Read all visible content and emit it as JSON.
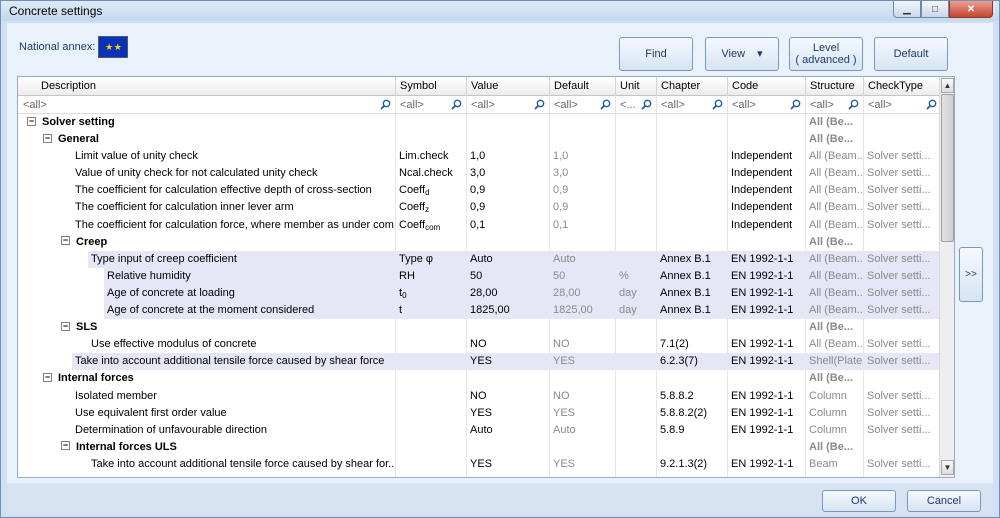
{
  "window": {
    "title": "Concrete settings",
    "minimize": "▁",
    "maximize": "□",
    "close": "✕"
  },
  "national_annex": {
    "label": "National annex:",
    "flag_glyph": "★ ★"
  },
  "toolbar": {
    "find": "Find",
    "view": "View",
    "view_arrow": "▾",
    "level_line1": "Level",
    "level_line2": "( advanced )",
    "default": "Default"
  },
  "columns": [
    "Description",
    "Symbol",
    "Value",
    "Default",
    "Unit",
    "Chapter",
    "Code",
    "Structure",
    "CheckType"
  ],
  "filters": [
    "<all>",
    "<all>",
    "<all>",
    "<all>",
    "<...",
    "<all>",
    "<all>",
    "<all>",
    "<all>"
  ],
  "rows": [
    {
      "indent": 0,
      "toggle": "⊟",
      "bold": true,
      "desc": "Solver setting",
      "symbol": "",
      "value": "",
      "default": "",
      "unit": "",
      "chapter": "",
      "code": "",
      "structure": "All (Be...",
      "structure_bold": true,
      "checktype": "",
      "hl": false
    },
    {
      "indent": 1,
      "toggle": "⊟",
      "bold": true,
      "desc": "General",
      "symbol": "",
      "value": "",
      "default": "",
      "unit": "",
      "chapter": "",
      "code": "",
      "structure": "All (Be...",
      "structure_bold": true,
      "checktype": "",
      "hl": false
    },
    {
      "indent": 2,
      "toggle": "",
      "bold": false,
      "desc": "Limit value of unity check",
      "symbol": "Lim.check",
      "value": "1,0",
      "default": "1,0",
      "unit": "",
      "chapter": "",
      "code": "Independent",
      "structure": "All (Beam...",
      "checktype": "Solver setti...",
      "hl": false
    },
    {
      "indent": 2,
      "toggle": "",
      "bold": false,
      "desc": "Value of unity check for not calculated unity check",
      "symbol": "Ncal.check",
      "value": "3,0",
      "default": "3,0",
      "unit": "",
      "chapter": "",
      "code": "Independent",
      "structure": "All (Beam...",
      "checktype": "Solver setti...",
      "hl": false
    },
    {
      "indent": 2,
      "toggle": "",
      "bold": false,
      "desc": "The coefficient for calculation effective depth of cross-section",
      "symbol": "Coeff",
      "sub": "d",
      "value": "0,9",
      "default": "0,9",
      "unit": "",
      "chapter": "",
      "code": "Independent",
      "structure": "All (Beam...",
      "checktype": "Solver setti...",
      "hl": false
    },
    {
      "indent": 2,
      "toggle": "",
      "bold": false,
      "desc": "The coefficient for calculation inner lever arm",
      "symbol": "Coeff",
      "sub": "z",
      "value": "0,9",
      "default": "0,9",
      "unit": "",
      "chapter": "",
      "code": "Independent",
      "structure": "All (Beam...",
      "checktype": "Solver setti...",
      "hl": false
    },
    {
      "indent": 2,
      "toggle": "",
      "bold": false,
      "desc": "The coefficient for calculation force, where member as under com...",
      "symbol": "Coeff",
      "sub": "com",
      "value": "0,1",
      "default": "0,1",
      "unit": "",
      "chapter": "",
      "code": "Independent",
      "structure": "All (Beam...",
      "checktype": "Solver setti...",
      "hl": false
    },
    {
      "indent": 2,
      "toggle": "⊟",
      "bold": true,
      "desc": "Creep",
      "symbol": "",
      "value": "",
      "default": "",
      "unit": "",
      "chapter": "",
      "code": "",
      "structure": "All (Be...",
      "structure_bold": true,
      "checktype": "",
      "hl": false
    },
    {
      "indent": 3,
      "toggle": "",
      "bold": false,
      "desc": "Type input of creep coefficient",
      "symbol": "Type φ",
      "value": "Auto",
      "default": "Auto",
      "unit": "",
      "chapter": "Annex B.1",
      "code": "EN 1992-1-1",
      "structure": "All (Beam...",
      "checktype": "Solver setti...",
      "hl": true
    },
    {
      "indent": 4,
      "toggle": "",
      "bold": false,
      "desc": "Relative humidity",
      "symbol": "RH",
      "value": "50",
      "default": "50",
      "unit": "%",
      "chapter": "Annex B.1",
      "code": "EN 1992-1-1",
      "structure": "All (Beam...",
      "checktype": "Solver setti...",
      "hl": true
    },
    {
      "indent": 4,
      "toggle": "",
      "bold": false,
      "desc": "Age of concrete at loading",
      "symbol": "t",
      "sub": "0",
      "value": "28,00",
      "default": "28,00",
      "unit": "day",
      "chapter": "Annex B.1",
      "code": "EN 1992-1-1",
      "structure": "All (Beam...",
      "checktype": "Solver setti...",
      "hl": true
    },
    {
      "indent": 4,
      "toggle": "",
      "bold": false,
      "desc": "Age of concrete at the moment considered",
      "symbol": "t",
      "value": "1825,00",
      "default": "1825,00",
      "unit": "day",
      "chapter": "Annex B.1",
      "code": "EN 1992-1-1",
      "structure": "All (Beam...",
      "checktype": "Solver setti...",
      "hl": true
    },
    {
      "indent": 2,
      "toggle": "⊟",
      "bold": true,
      "desc": "SLS",
      "symbol": "",
      "value": "",
      "default": "",
      "unit": "",
      "chapter": "",
      "code": "",
      "structure": "All (Be...",
      "structure_bold": true,
      "checktype": "",
      "hl": false
    },
    {
      "indent": 3,
      "toggle": "",
      "bold": false,
      "desc": "Use effective modulus of concrete",
      "symbol": "",
      "value": "NO",
      "default": "NO",
      "unit": "",
      "chapter": "7.1(2)",
      "code": "EN 1992-1-1",
      "structure": "All (Beam...",
      "checktype": "Solver setti...",
      "hl": false
    },
    {
      "indent": 2,
      "toggle": "",
      "bold": false,
      "desc": "Take into account additional tensile force caused by shear force",
      "symbol": "",
      "value": "YES",
      "default": "YES",
      "unit": "",
      "chapter": "6.2.3(7)",
      "code": "EN 1992-1-1",
      "structure": "Shell(Plate)",
      "checktype": "Solver setti...",
      "hl": true
    },
    {
      "indent": 1,
      "toggle": "⊟",
      "bold": true,
      "desc": "Internal forces",
      "symbol": "",
      "value": "",
      "default": "",
      "unit": "",
      "chapter": "",
      "code": "",
      "structure": "All (Be...",
      "structure_bold": true,
      "checktype": "",
      "hl": false
    },
    {
      "indent": 2,
      "toggle": "",
      "bold": false,
      "desc": "Isolated member",
      "symbol": "",
      "value": "NO",
      "default": "NO",
      "unit": "",
      "chapter": "5.8.8.2",
      "code": "EN 1992-1-1",
      "structure": "Column",
      "checktype": "Solver setti...",
      "hl": false
    },
    {
      "indent": 2,
      "toggle": "",
      "bold": false,
      "desc": "Use equivalent first order value",
      "symbol": "",
      "value": "YES",
      "default": "YES",
      "unit": "",
      "chapter": "5.8.8.2(2)",
      "code": "EN 1992-1-1",
      "structure": "Column",
      "checktype": "Solver setti...",
      "hl": false
    },
    {
      "indent": 2,
      "toggle": "",
      "bold": false,
      "desc": "Determination of unfavourable direction",
      "symbol": "",
      "value": "Auto",
      "default": "Auto",
      "unit": "",
      "chapter": "5.8.9",
      "code": "EN 1992-1-1",
      "structure": "Column",
      "checktype": "Solver setti...",
      "hl": false
    },
    {
      "indent": 2,
      "toggle": "⊟",
      "bold": true,
      "desc": "Internal forces ULS",
      "symbol": "",
      "value": "",
      "default": "",
      "unit": "",
      "chapter": "",
      "code": "",
      "structure": "All (Be...",
      "structure_bold": true,
      "checktype": "",
      "hl": false
    },
    {
      "indent": 3,
      "toggle": "",
      "bold": false,
      "desc": "Take into account additional tensile force caused by shear for...",
      "symbol": "",
      "value": "YES",
      "default": "YES",
      "unit": "",
      "chapter": "9.2.1.3(2)",
      "code": "EN 1992-1-1",
      "structure": "Beam",
      "checktype": "Solver setti...",
      "hl": false
    }
  ],
  "expand_button": ">>",
  "scroll": {
    "up": "▲",
    "down": "▼"
  },
  "ok": "OK",
  "cancel": "Cancel"
}
